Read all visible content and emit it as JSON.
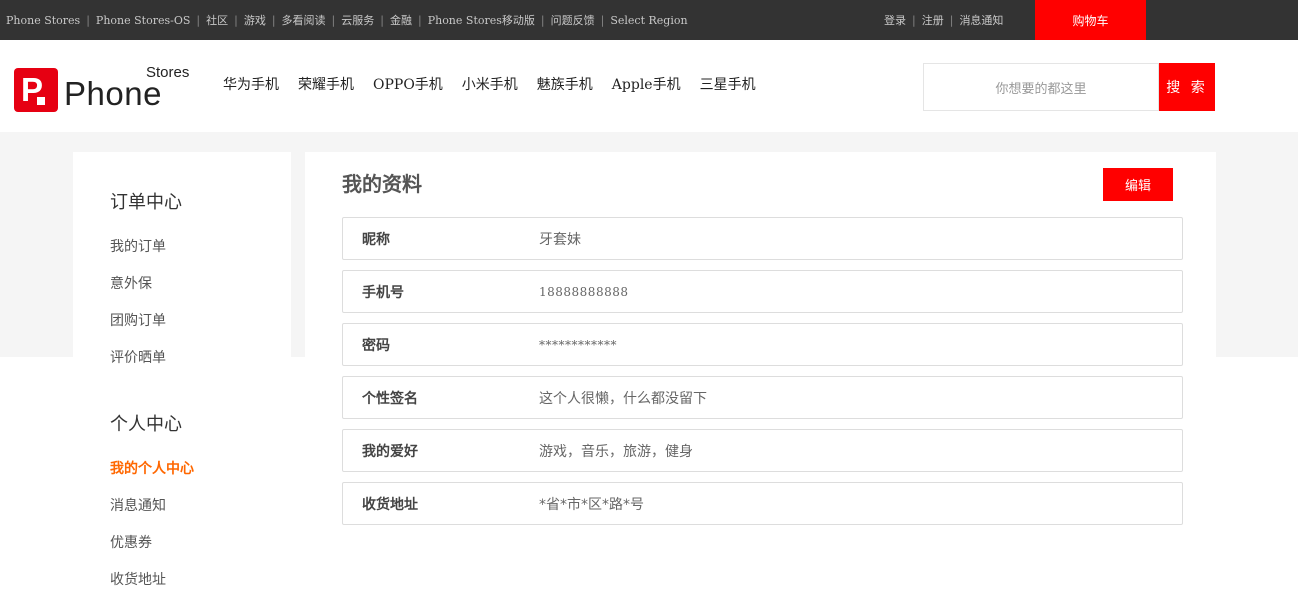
{
  "topbar": {
    "links": [
      "Phone Stores",
      "Phone Stores-OS",
      "社区",
      "游戏",
      "多看阅读",
      "云服务",
      "金融",
      "Phone Stores移动版",
      "问题反馈",
      "Select Region"
    ],
    "user_links": [
      "登录",
      "注册",
      "消息通知"
    ],
    "separator": "|",
    "cart_label": "购物车"
  },
  "logo": {
    "mark": "P",
    "word": "Phone",
    "sub": "Stores"
  },
  "nav": {
    "items": [
      "华为手机",
      "荣耀手机",
      "OPPO手机",
      "小米手机",
      "魅族手机",
      "Apple手机",
      "三星手机"
    ]
  },
  "search": {
    "placeholder": "你想要的都这里",
    "button_label": "搜 索"
  },
  "sidebar": {
    "groups": [
      {
        "title": "订单中心",
        "items": [
          "我的订单",
          "意外保",
          "团购订单",
          "评价晒单"
        ]
      },
      {
        "title": "个人中心",
        "items": [
          "我的个人中心",
          "消息通知",
          "优惠券",
          "收货地址"
        ]
      }
    ]
  },
  "profile": {
    "title": "我的资料",
    "edit_label": "编辑",
    "fields": [
      {
        "label": "昵称",
        "value": "牙套妹"
      },
      {
        "label": "手机号",
        "value": "18888888888"
      },
      {
        "label": "密码",
        "value": "************"
      },
      {
        "label": "个性签名",
        "value": "这个人很懒，什么都没留下"
      },
      {
        "label": "我的爱好",
        "value": "游戏，音乐，旅游，健身"
      },
      {
        "label": "收货地址",
        "value": "*省*市*区*路*号"
      }
    ]
  },
  "colors": {
    "accent": "#ff0000",
    "active_link": "#ff6700",
    "topbar_bg": "#333333"
  }
}
